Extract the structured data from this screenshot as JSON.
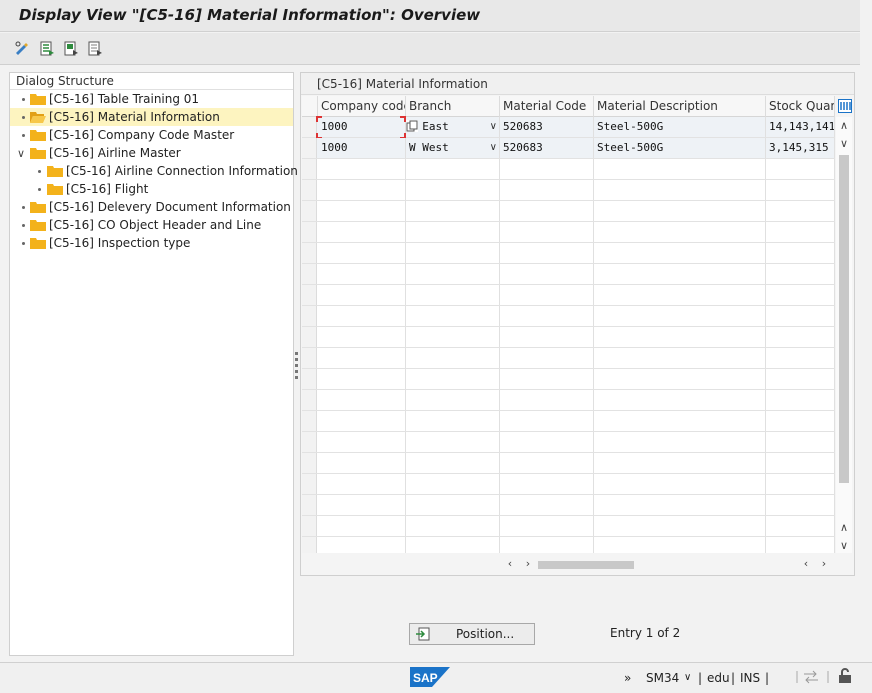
{
  "window": {
    "title": "Display View \"[C5-16] Material Information\": Overview"
  },
  "toolbar": {
    "icons": [
      "display-change-icon",
      "select-all-icon",
      "select-block-icon",
      "deselect-all-icon"
    ]
  },
  "dialog_structure": {
    "heading": "Dialog Structure",
    "items": [
      {
        "label": "[C5-16] Table Training 01",
        "level": 0,
        "expanded": false,
        "selected": false
      },
      {
        "label": "[C5-16] Material Information",
        "level": 0,
        "expanded": false,
        "selected": true
      },
      {
        "label": "[C5-16] Company Code Master",
        "level": 0,
        "expanded": false,
        "selected": false
      },
      {
        "label": "[C5-16] Airline Master",
        "level": 0,
        "expanded": true,
        "selected": false
      },
      {
        "label": "[C5-16] Airline Connection Information",
        "level": 1,
        "expanded": false,
        "selected": false
      },
      {
        "label": "[C5-16] Flight",
        "level": 1,
        "expanded": false,
        "selected": false
      },
      {
        "label": "[C5-16] Delevery Document Information",
        "level": 0,
        "expanded": false,
        "selected": false
      },
      {
        "label": "[C5-16] CO Object Header and Line",
        "level": 0,
        "expanded": false,
        "selected": false
      },
      {
        "label": "[C5-16] Inspection type",
        "level": 0,
        "expanded": false,
        "selected": false
      }
    ]
  },
  "table": {
    "title": "[C5-16] Material Information",
    "columns": [
      "Company code",
      "Branch",
      "Material Code",
      "Material Description",
      "Stock Quant"
    ],
    "rows": [
      [
        "1000",
        "E East",
        "520683",
        "Steel-500G",
        "14,143,141"
      ],
      [
        "1000",
        "W West",
        "520683",
        "Steel-500G",
        "3,145,315"
      ]
    ]
  },
  "footer": {
    "position_button": "Position...",
    "entry_text": "Entry 1 of 2"
  },
  "status": {
    "nav": "»",
    "transaction": "SM34",
    "sep1": "|",
    "client": "edu",
    "sep2": "|",
    "mode": "INS",
    "sep3": "|"
  },
  "colors": {
    "selected_row": "#fdf4c0",
    "folder": "#f3b21b",
    "sap_blue": "#1a73c8"
  }
}
